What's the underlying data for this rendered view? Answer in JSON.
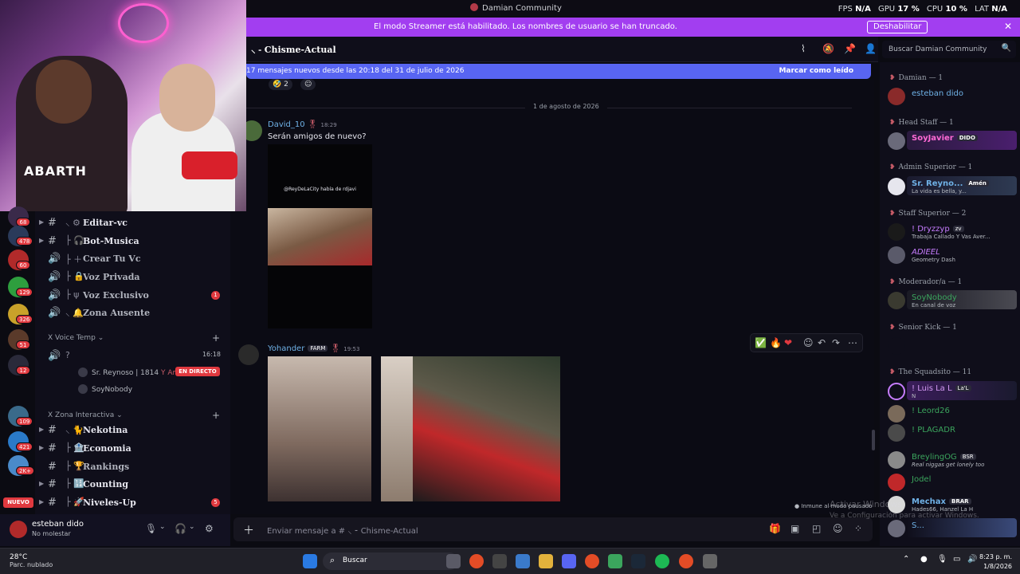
{
  "window": {
    "title": "Damian Community"
  },
  "stats": [
    {
      "label": "FPS",
      "value": "N/A"
    },
    {
      "label": "GPU",
      "value": "17 %"
    },
    {
      "label": "CPU",
      "value": "10 %"
    },
    {
      "label": "LAT",
      "value": "N/A"
    }
  ],
  "banner": {
    "message": "El modo Streamer está habilitado. Los nombres de usuario se han truncado.",
    "button": "Deshabilitar",
    "close": "✕"
  },
  "rail": {
    "badges": [
      "68",
      "478",
      "60",
      "129",
      "326",
      "51",
      "12",
      "109",
      "421",
      "2K+"
    ],
    "new_label": "NUEVO"
  },
  "channels": {
    "list": [
      {
        "name": "Editar-vc",
        "icon": "⚙",
        "type": "text",
        "badge": ""
      },
      {
        "name": "Bot-Musica",
        "icon": "🎧",
        "type": "text",
        "badge": ""
      },
      {
        "name": "Crear Tu Vc",
        "icon": "➕",
        "type": "voice",
        "badge": ""
      },
      {
        "name": "Voz Privada",
        "icon": "🔒",
        "type": "voice",
        "badge": ""
      },
      {
        "name": "Voz Exclusivo",
        "icon": "ψ",
        "type": "voice",
        "badge": "1"
      },
      {
        "name": "Zona Ausente",
        "icon": "🔔",
        "type": "voice",
        "badge": ""
      }
    ],
    "voice_temp": {
      "category": "X Voice Temp",
      "channel_name": "?",
      "timer": "16:18",
      "users": [
        "Sr. Reynoso | 1814",
        "SoyNobody"
      ],
      "user_tag": "Amén",
      "live_label": "EN DIRECTO"
    },
    "zona": {
      "category": "X Zona Interactiva",
      "list": [
        {
          "name": "Nekotina",
          "icon": "🐈",
          "type": "text",
          "badge": ""
        },
        {
          "name": "Economia",
          "icon": "🏦",
          "type": "text",
          "badge": ""
        },
        {
          "name": "Rankings",
          "icon": "🏆",
          "type": "text",
          "badge": ""
        },
        {
          "name": "Counting",
          "icon": "🔢",
          "type": "text",
          "badge": ""
        },
        {
          "name": "Niveles-Up",
          "icon": "🚀",
          "type": "text",
          "badge": "5"
        }
      ]
    }
  },
  "user_panel": {
    "name": "esteban dido",
    "status": "No molestar"
  },
  "chat": {
    "channel": "Chisme-Actual",
    "new_messages": "17 mensajes nuevos desde las 20:18 del 31 de julio de 2026",
    "mark_read": "Marcar como leído",
    "reaction_count": "2",
    "date_divider": "1 de agosto de 2026",
    "messages": [
      {
        "author": "David_10",
        "time": "18:29",
        "text": "Serán amigos de nuevo?",
        "video_caption": "@ReyDeLaCity había de rdjavi"
      },
      {
        "author": "Yohander",
        "tag": "FARM",
        "time": "19:53"
      }
    ],
    "immune": "Inmune al modo pausado",
    "input_placeholder": "Enviar mensaje a #",
    "input_channel": "Chisme-Actual"
  },
  "search": {
    "placeholder": "Buscar Damian Community"
  },
  "members": {
    "roles": [
      {
        "name": "Damian — 1",
        "members": [
          {
            "name": "esteban dido",
            "sub": "",
            "color": "#6fb1e6"
          }
        ]
      },
      {
        "name": "Head Staff — 1",
        "members": [
          {
            "name": "SoyJavier",
            "tag": "DIDO",
            "sub": "",
            "color": "#ff6ad5"
          }
        ]
      },
      {
        "name": "Admin Superior — 1",
        "members": [
          {
            "name": "Sr. Reyno...",
            "tag": "Amén",
            "sub": "La vida es bella, y...",
            "color": "#6fb1e6"
          }
        ]
      },
      {
        "name": "Staff Superior — 2",
        "members": [
          {
            "name": "! Dryzzyp",
            "tag": "zv",
            "sub": "Trabaja Callado Y Vas Aver...",
            "color": "#c77dff"
          },
          {
            "name": "ADIEEL",
            "sub": "Geometry Dash",
            "color": "#c77dff"
          }
        ]
      },
      {
        "name": "Moderador/a — 1",
        "members": [
          {
            "name": "SoyNobody",
            "sub": "En canal de voz",
            "color": "#3ba55d"
          }
        ]
      },
      {
        "name": "Senior Kick — 1",
        "members": [
          {
            "name": "",
            "sub": "",
            "color": "#c77dff"
          }
        ]
      },
      {
        "name": "The Squadsito — 11",
        "members": [
          {
            "name": "! Luis La L",
            "tag": "La'L",
            "sub": "N",
            "color": "#d59af5"
          },
          {
            "name": "! Leord26",
            "sub": "",
            "color": "#3ba55d"
          },
          {
            "name": "! PLAGADR",
            "sub": "",
            "color": "#3ba55d"
          },
          {
            "name": "BreylingOG",
            "tag": "BSR",
            "sub": "Real niggas get lonely too",
            "color": "#3ba55d"
          },
          {
            "name": "Jodel",
            "sub": "",
            "color": "#3ba55d"
          },
          {
            "name": "Mechax",
            "tag": "BRAR",
            "sub": "Hades66, Hanzel La H",
            "color": "#6fb1e6"
          },
          {
            "name": "S...",
            "sub": "",
            "color": "#6fb1e6"
          }
        ]
      }
    ]
  },
  "watermark": {
    "line1": "Activar Windows",
    "line2": "Ve a Configuración para activar Windows."
  },
  "taskbar": {
    "weather_temp": "28°C",
    "weather_desc": "Parc. nublado",
    "search": "Buscar",
    "time": "8:23 p. m.",
    "date": "1/8/2026"
  },
  "colors": {
    "accent": "#5865f2",
    "banner": "#a23ef0",
    "danger": "#e0393f"
  }
}
